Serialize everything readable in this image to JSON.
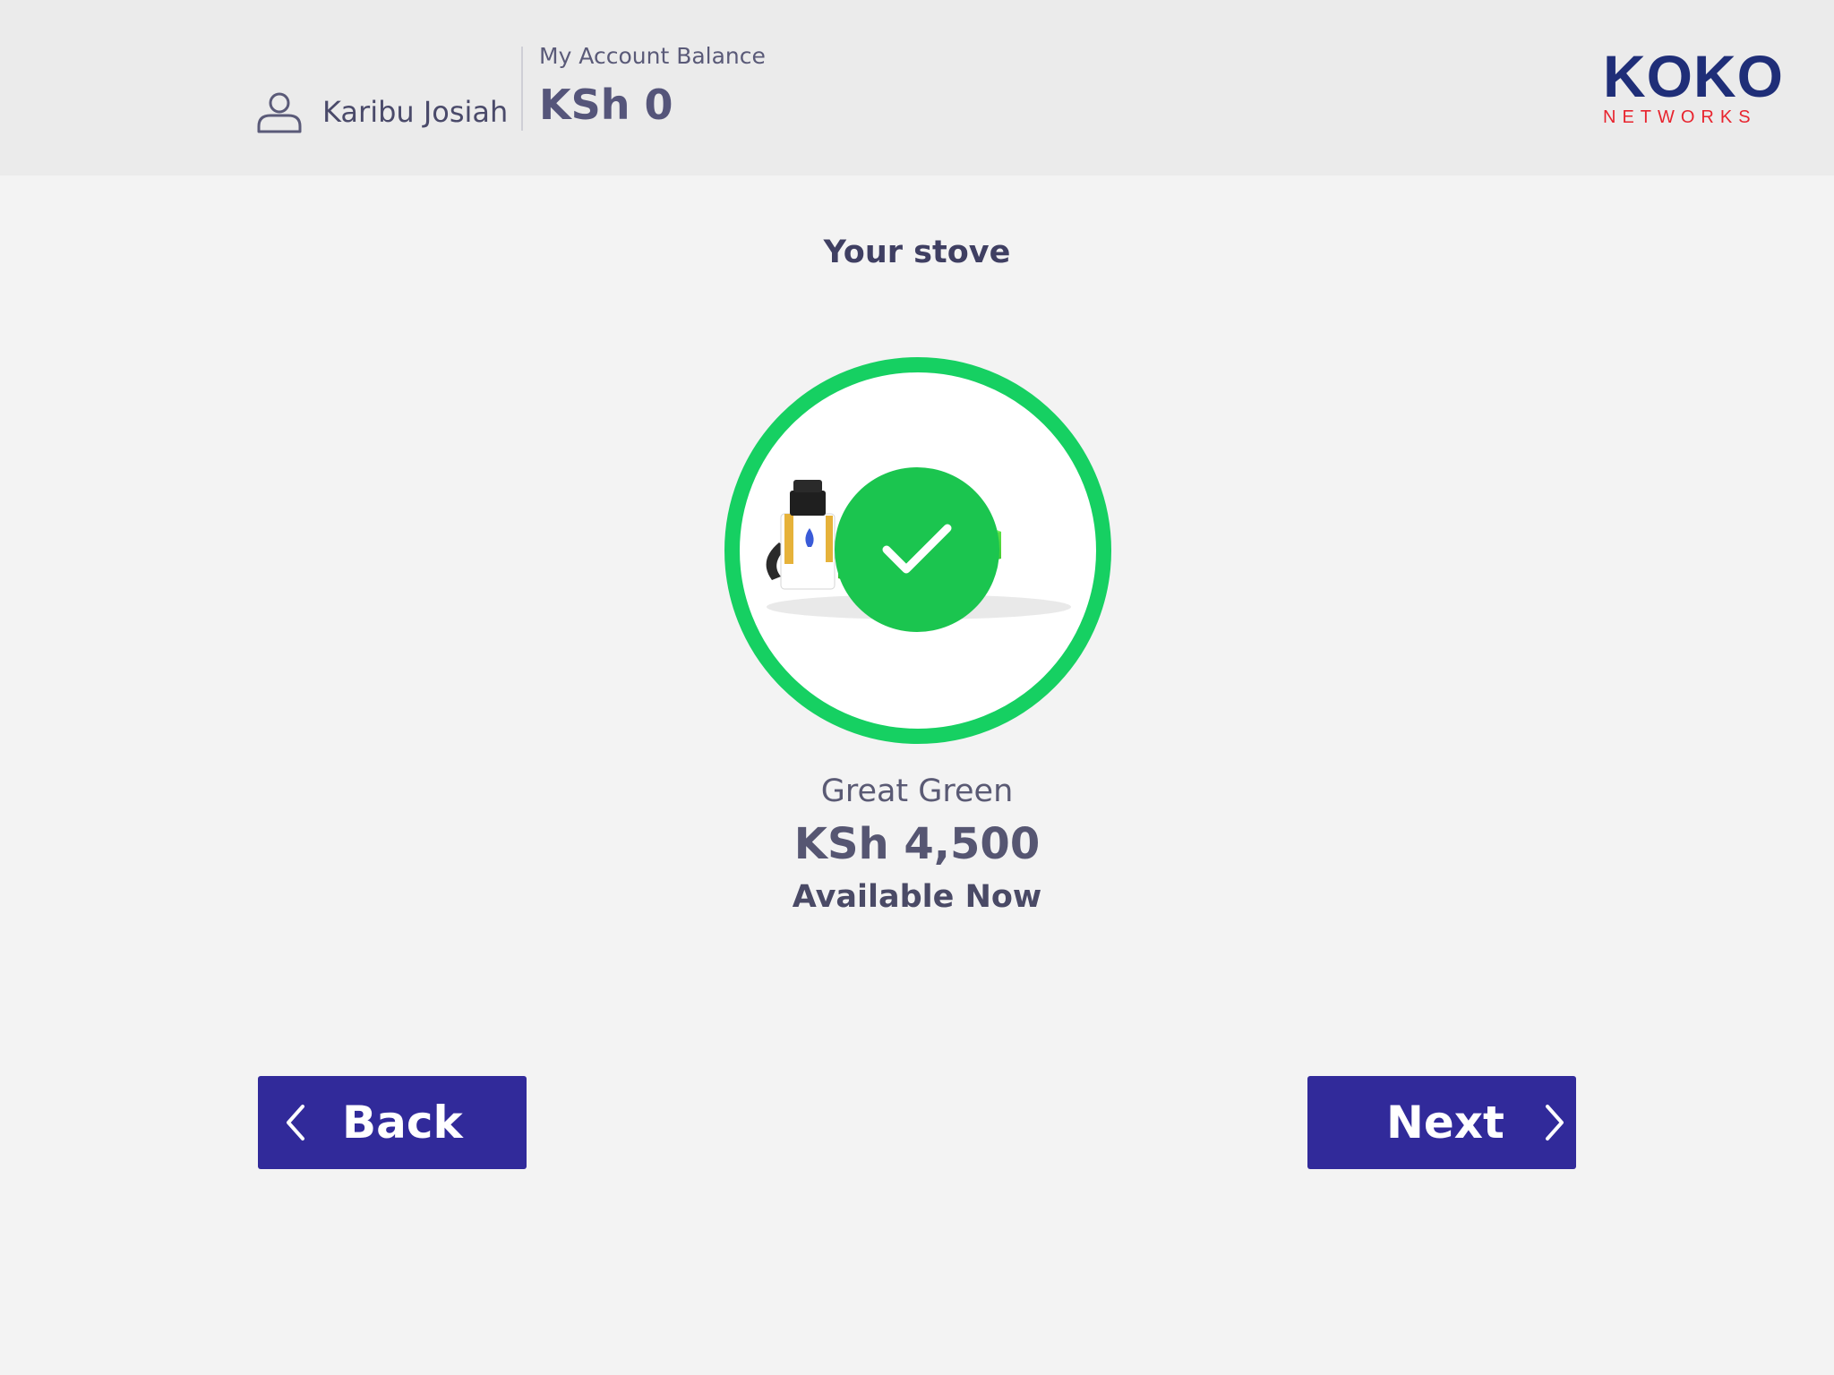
{
  "header": {
    "greeting": "Karibu Josiah",
    "balance_label": "My Account Balance",
    "balance_value": "KSh 0",
    "user_icon": "user-icon",
    "logo": {
      "main": "KOKO",
      "sub": "NETWORKS"
    }
  },
  "page": {
    "title": "Your stove"
  },
  "product": {
    "name": "Great Green",
    "price": "KSh 4,500",
    "status": "Available Now",
    "selected_icon": "checkmark-icon"
  },
  "actions": {
    "back_label": "Back",
    "next_label": "Next"
  },
  "colors": {
    "header_bg": "#ebebeb",
    "page_bg": "#f3f3f3",
    "button": "#312a9a",
    "ring": "#16d062",
    "check": "#1bc54f",
    "logo_blue": "#1f2e78",
    "logo_red": "#e8242e"
  }
}
